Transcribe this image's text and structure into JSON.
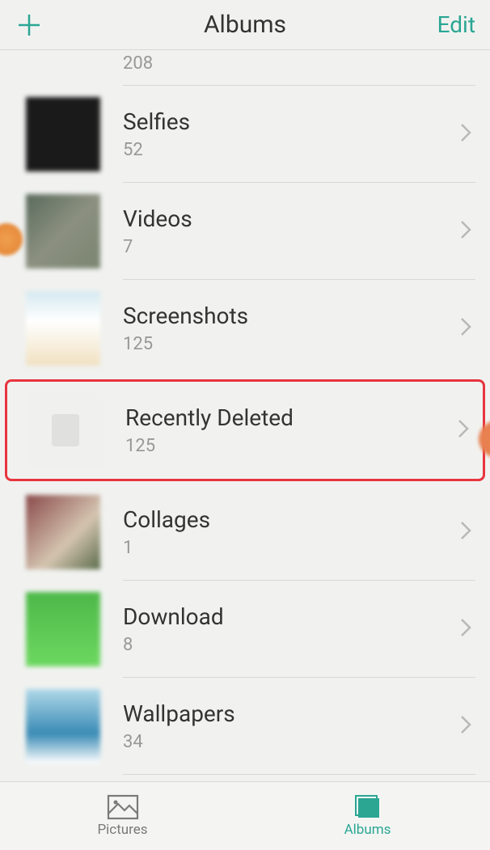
{
  "header": {
    "title": "Albums",
    "edit_label": "Edit"
  },
  "albums": [
    {
      "title": "",
      "count": "208",
      "thumb_class": ""
    },
    {
      "title": "Selfies",
      "count": "52",
      "thumb_class": "dark"
    },
    {
      "title": "Videos",
      "count": "7",
      "thumb_class": "people"
    },
    {
      "title": "Screenshots",
      "count": "125",
      "thumb_class": "screenshots"
    },
    {
      "title": "Recently Deleted",
      "count": "125",
      "thumb_class": "deleted",
      "highlighted": true
    },
    {
      "title": "Collages",
      "count": "1",
      "thumb_class": "collages"
    },
    {
      "title": "Download",
      "count": "8",
      "thumb_class": "download"
    },
    {
      "title": "Wallpapers",
      "count": "34",
      "thumb_class": "wallpapers"
    }
  ],
  "bottom_nav": {
    "pictures_label": "Pictures",
    "albums_label": "Albums"
  },
  "colors": {
    "accent": "#2aa693",
    "highlight_border": "#e8343e"
  }
}
